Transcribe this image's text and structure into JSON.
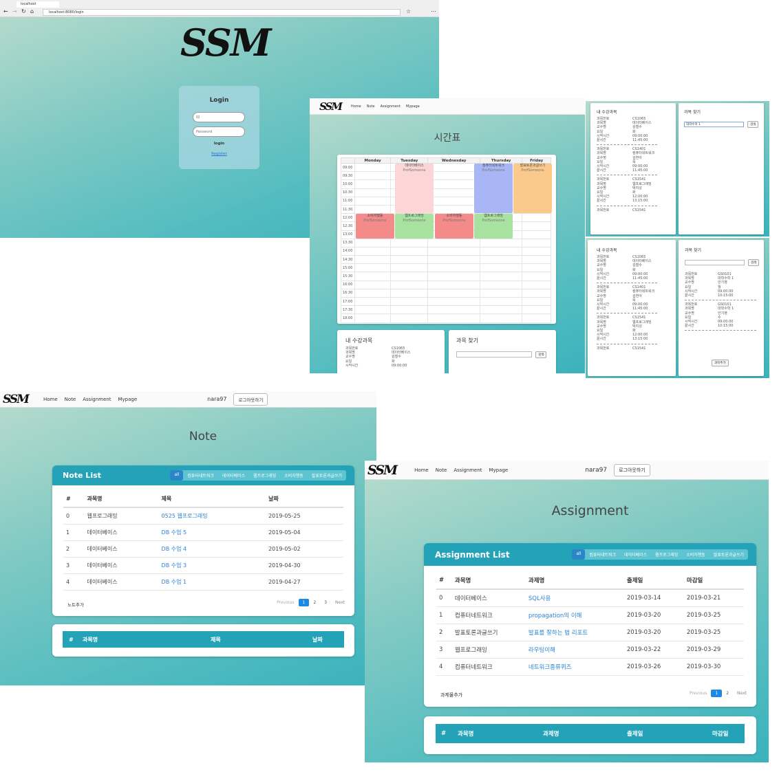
{
  "login": {
    "tab_title": "localhost",
    "address": "localhost:8080/login",
    "logo": "SSM",
    "title": "Login",
    "id_placeholder": "ID",
    "password_placeholder": "Password",
    "login_label": "login",
    "register_label": "Register"
  },
  "nav": {
    "home": "Home",
    "note": "Note",
    "assignment": "Assignment",
    "mypage": "Mypage",
    "username": "nara97",
    "logout": "로그아웃하기"
  },
  "timetable": {
    "title": "시간표",
    "days": [
      "Monday",
      "Tuesday",
      "Wednesday",
      "Thursday",
      "Friday"
    ],
    "times": [
      "09:00",
      "09:30",
      "10:00",
      "10:30",
      "11:00",
      "11:30",
      "12:00",
      "12:30",
      "13:00",
      "13:30",
      "14:00",
      "14:30",
      "15:00",
      "15:30",
      "16:00",
      "16:30",
      "17:00",
      "17:30",
      "18:00"
    ],
    "classes": [
      {
        "name": "데이터베이스",
        "prof": "ProfSomeone",
        "color": "#fcd6d6"
      },
      {
        "name": "컴퓨터네트워크",
        "prof": "ProfSomeone",
        "color": "#a9b6f6"
      },
      {
        "name": "발표토론과글쓰기",
        "prof": "ProfSomeone",
        "color": "#fbc98b"
      },
      {
        "name": "소비자행동",
        "prof": "ProfSomeone",
        "color": "#f48a8a"
      },
      {
        "name": "웹프로그래밍",
        "prof": "ProfSomeone",
        "color": "#a8e2a0"
      },
      {
        "name": "소비자행동",
        "prof": "ProfSomeone",
        "color": "#f48a8a"
      },
      {
        "name": "웹프로그래밍",
        "prof": "ProfSomeone",
        "color": "#a8e2a0"
      }
    ]
  },
  "my_courses": {
    "title": "내 수강과목",
    "labels": [
      "과목번호",
      "과목명",
      "교수명",
      "요일",
      "시작시간",
      "끝시간"
    ],
    "courses": [
      {
        "code": "CS1065",
        "name": "데이터베이스",
        "prof": "김철수",
        "day": "화",
        "start": "09:00:00",
        "end": "11:45:00"
      },
      {
        "code": "CS1401",
        "name": "컴퓨터네트워크",
        "prof": "김연아",
        "day": "목",
        "start": "09:00:00",
        "end": "11:45:00"
      },
      {
        "code": "CS1541",
        "name": "웹프로그래밍",
        "prof": "박지성",
        "day": "화",
        "start": "12:00:00",
        "end": "13:15:00"
      }
    ],
    "last_code_label": "과목번호",
    "last_code": "CS1541"
  },
  "find_course": {
    "title": "과목 찾기",
    "search_value": "대학수학 1",
    "search_button": "검색",
    "results": [
      {
        "code": "GS0101",
        "name": "대학수학 1",
        "prof": "안기영",
        "day": "월",
        "start": "09:00:00",
        "end": "10:15:00"
      },
      {
        "code": "GS0101",
        "name": "대학수학 1",
        "prof": "안기영",
        "day": "수",
        "start": "09:00:00",
        "end": "10:15:00"
      }
    ],
    "add_button": "과목추가"
  },
  "note": {
    "page_title": "Note",
    "list_title": "Note List",
    "filters": [
      "all",
      "컴퓨터네트워크",
      "데이터베이스",
      "웹프로그래밍",
      "소비자행동",
      "발표토론과글쓰기"
    ],
    "columns": [
      "#",
      "과목명",
      "제목",
      "날짜"
    ],
    "rows": [
      {
        "idx": "0",
        "course": "웹프로그래밍",
        "title": "0525 웹프로그래밍",
        "date": "2019-05-25"
      },
      {
        "idx": "1",
        "course": "데이터베이스",
        "title": "DB 수업 5",
        "date": "2019-05-04"
      },
      {
        "idx": "2",
        "course": "데이터베이스",
        "title": "DB 수업 4",
        "date": "2019-05-02"
      },
      {
        "idx": "3",
        "course": "데이터베이스",
        "title": "DB 수업 3",
        "date": "2019-04-30"
      },
      {
        "idx": "4",
        "course": "데이터베이스",
        "title": "DB 수업 1",
        "date": "2019-04-27"
      }
    ],
    "add_label": "노트추가",
    "pager": {
      "prev": "Previous",
      "pages": [
        "1",
        "2",
        "3"
      ],
      "next": "Next"
    }
  },
  "assignment": {
    "page_title": "Assignment",
    "list_title": "Assignment List",
    "filters": [
      "all",
      "컴퓨터네트워크",
      "데이터베이스",
      "웹프로그래밍",
      "소비자행동",
      "발표토론과글쓰기"
    ],
    "columns": [
      "#",
      "과목명",
      "과제명",
      "출제일",
      "마감일"
    ],
    "rows": [
      {
        "idx": "0",
        "course": "데이터베이스",
        "title": "SQL사용",
        "given": "2019-03-14",
        "due": "2019-03-21"
      },
      {
        "idx": "1",
        "course": "컴퓨터네트워크",
        "title": "propagation의 이해",
        "given": "2019-03-20",
        "due": "2019-03-25"
      },
      {
        "idx": "2",
        "course": "발표토론과글쓰기",
        "title": "발표를 잘하는 법 리포트",
        "given": "2019-03-20",
        "due": "2019-03-25"
      },
      {
        "idx": "3",
        "course": "웹프로그래밍",
        "title": "라우팅이해",
        "given": "2019-03-22",
        "due": "2019-03-29"
      },
      {
        "idx": "4",
        "course": "컴퓨터네트워크",
        "title": "네트워크종류퀴즈",
        "given": "2019-03-26",
        "due": "2019-03-30"
      }
    ],
    "add_label": "과제물추가",
    "pager": {
      "prev": "Previous",
      "pages": [
        "1",
        "2"
      ],
      "next": "Next"
    }
  }
}
